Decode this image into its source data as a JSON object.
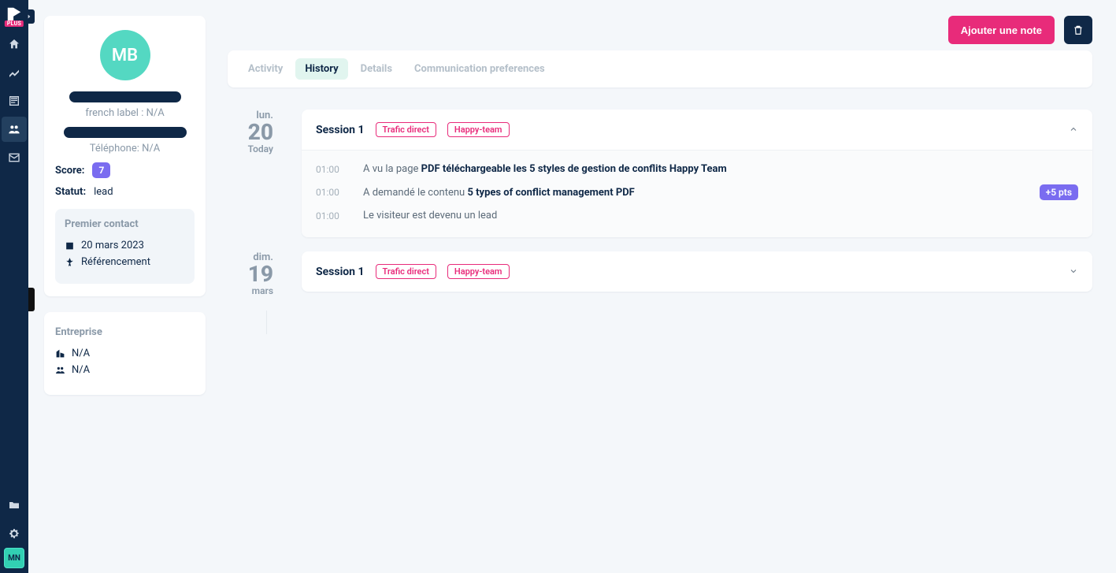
{
  "rail": {
    "plus_badge": "PLUS",
    "user_initials": "MN"
  },
  "profile": {
    "avatar_initials": "MB",
    "french_label_text": "french label : N/A",
    "phone_text": "Téléphone: N/A",
    "score_label": "Score:",
    "score_value": "7",
    "status_label": "Statut:",
    "status_value": "lead",
    "first_contact_title": "Premier contact",
    "first_contact_date": "20 mars 2023",
    "first_contact_source": "Référencement"
  },
  "company": {
    "title": "Entreprise",
    "name": "N/A",
    "people": "N/A"
  },
  "actions": {
    "add_note": "Ajouter une note"
  },
  "tabs": {
    "activity": "Activity",
    "history": "History",
    "details": "Details",
    "comm_prefs": "Communication preferences"
  },
  "sessions": [
    {
      "dow": "lun.",
      "day": "20",
      "sub": "Today",
      "title": "Session 1",
      "tags": [
        "Trafic direct",
        "Happy-team"
      ],
      "expanded": true,
      "events": [
        {
          "time": "01:00",
          "prefix": "A vu la page ",
          "bold": "PDF téléchargeable les 5 styles de gestion de conflits Happy Team",
          "points": null
        },
        {
          "time": "01:00",
          "prefix": "A demandé le contenu ",
          "bold": "5 types of conflict management PDF",
          "points": "+5 pts"
        },
        {
          "time": "01:00",
          "prefix": "Le visiteur est devenu un lead",
          "bold": "",
          "points": null
        }
      ]
    },
    {
      "dow": "dim.",
      "day": "19",
      "sub": "mars",
      "title": "Session 1",
      "tags": [
        "Trafic direct",
        "Happy-team"
      ],
      "expanded": false,
      "events": []
    }
  ]
}
